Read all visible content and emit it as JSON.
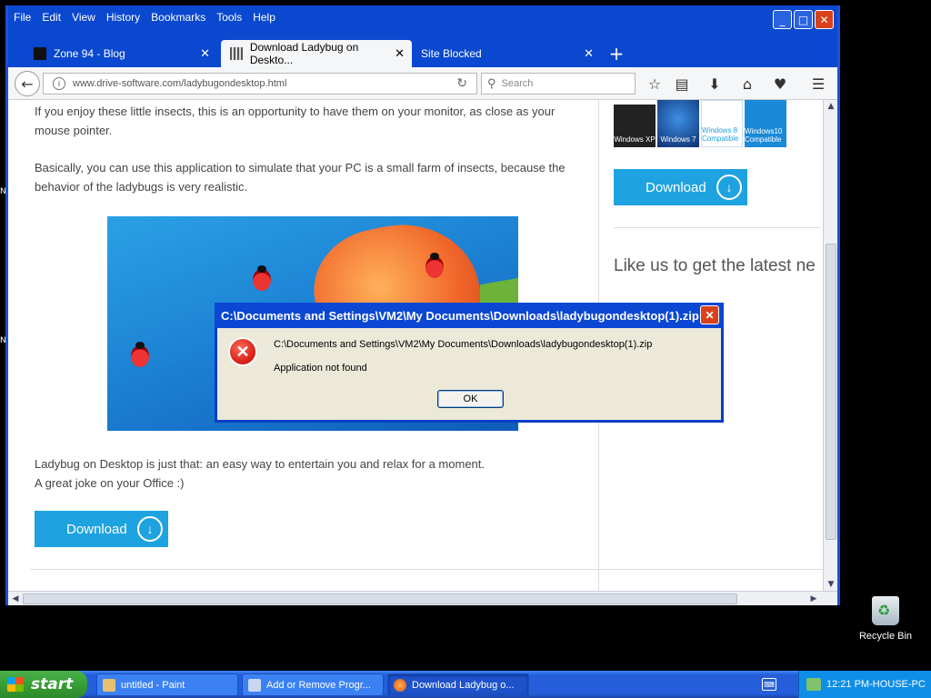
{
  "browser": {
    "menu": [
      "File",
      "Edit",
      "View",
      "History",
      "Bookmarks",
      "Tools",
      "Help"
    ],
    "tabs": [
      {
        "label": "Zone 94 - Blog",
        "active": false
      },
      {
        "label": "Download Ladybug on Deskto...",
        "active": true
      },
      {
        "label": "Site Blocked",
        "active": false
      }
    ],
    "url": "www.drive-software.com/ladybugondesktop.html",
    "search_placeholder": "Search"
  },
  "page": {
    "para1": "If you enjoy these little insects, this is an opportunity to have them on your monitor, as close as your mouse pointer.",
    "para2": "Basically, you can use this application to simulate that your PC is a small farm of insects, because the behavior of the ladybugs is very realistic.",
    "para3_line1": "Ladybug on Desktop is just that: an easy way to entertain you and relax for a moment.",
    "para3_line2": "A great joke on your Office :)",
    "download_label": "Download",
    "side_download_label": "Download",
    "os_logos": [
      "Windows XP",
      "Windows 7",
      "Windows 8 Compatible",
      "Windows10 Compatible"
    ],
    "like_us": "Like us to get the latest ne"
  },
  "dialog": {
    "title": "C:\\Documents and Settings\\VM2\\My Documents\\Downloads\\ladybugondesktop(1).zip",
    "path": "C:\\Documents and Settings\\VM2\\My Documents\\Downloads\\ladybugondesktop(1).zip",
    "message": "Application not found",
    "ok_label": "OK"
  },
  "desktop": {
    "recycle_bin": "Recycle Bin"
  },
  "taskbar": {
    "start_label": "start",
    "buttons": [
      {
        "label": "untitled - Paint",
        "active": false
      },
      {
        "label": "Add or Remove Progr...",
        "active": false
      },
      {
        "label": "Download Ladybug o...",
        "active": true
      }
    ],
    "clock": "12:21 PM-HOUSE-PC"
  },
  "colors": {
    "xp_blue": "#0a48cf",
    "download_blue": "#1ea3e0",
    "start_green": "#379e35"
  }
}
